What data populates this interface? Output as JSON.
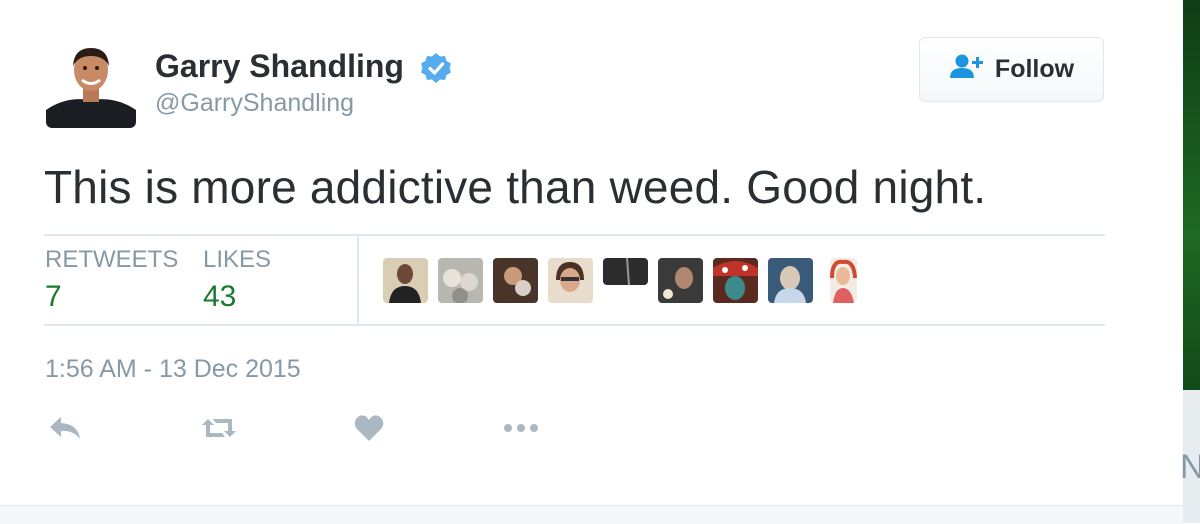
{
  "user": {
    "name": "Garry Shandling",
    "handle": "@GarryShandling",
    "verified_icon": "verified-badge-icon",
    "verified_color": "#55acee"
  },
  "follow_button": {
    "label": "Follow",
    "icon": "add-user-icon",
    "icon_color": "#1b95e0"
  },
  "tweet": {
    "text": "This is more addictive than weed. Good night."
  },
  "stats": {
    "retweets_label": "RETWEETS",
    "retweets_count": "7",
    "likes_label": "LIKES",
    "likes_count": "43",
    "count_color": "#1a7a2e"
  },
  "liker_avatars_count": 9,
  "timestamp": "1:56 AM - 13 Dec 2015",
  "actions": [
    "reply-icon",
    "retweet-icon",
    "like-icon",
    "more-icon"
  ],
  "colors": {
    "text": "#292f33",
    "muted": "#8899a6",
    "divider": "#e1e8ed"
  }
}
